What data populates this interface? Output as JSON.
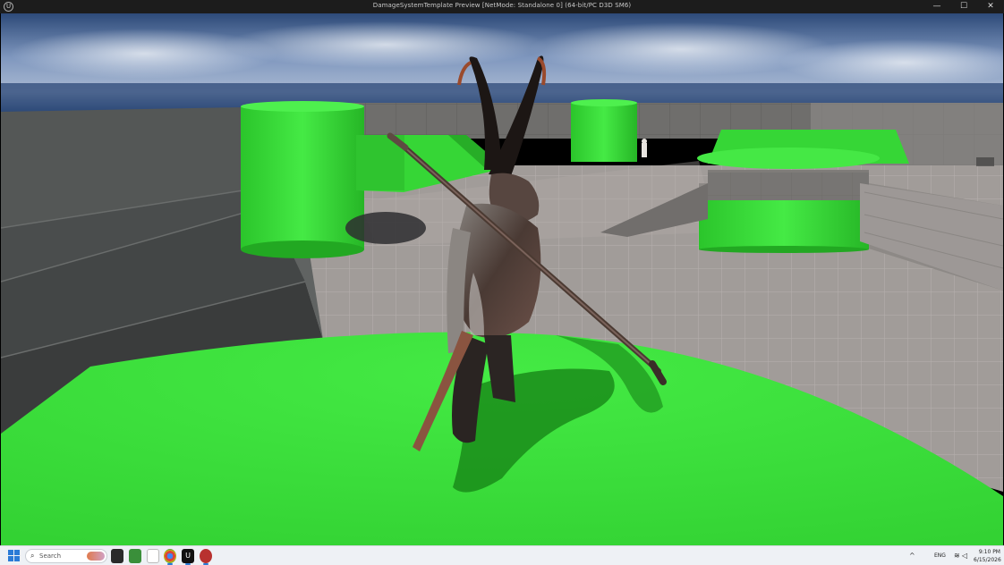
{
  "window": {
    "title": "DamageSystemTemplate Preview [NetMode: Standalone 0] (64-bit/PC D3D SM6)",
    "controls": {
      "minimize": "—",
      "maximize": "☐",
      "close": "✕"
    }
  },
  "viewport": {
    "colors": {
      "green": "#38e038",
      "floor": "#9c9794",
      "wall": "#7a7876",
      "sky_top": "#2f4b7a",
      "sky_low": "#9bb0cf"
    }
  },
  "taskbar": {
    "search_placeholder": "Search",
    "apps": [
      {
        "name": "file-explorer",
        "icon": "folder-icon"
      },
      {
        "name": "media",
        "icon": "media-icon"
      },
      {
        "name": "chrome",
        "icon": "chrome-icon",
        "active": true
      },
      {
        "name": "unreal-engine",
        "icon": "unreal-icon",
        "active": true
      },
      {
        "name": "app",
        "icon": "app-icon",
        "active": true
      }
    ],
    "tray": {
      "chevron": "^",
      "lang": "ENG"
    },
    "clock": {
      "time": "9:10 PM",
      "date": "6/15/2026"
    }
  }
}
